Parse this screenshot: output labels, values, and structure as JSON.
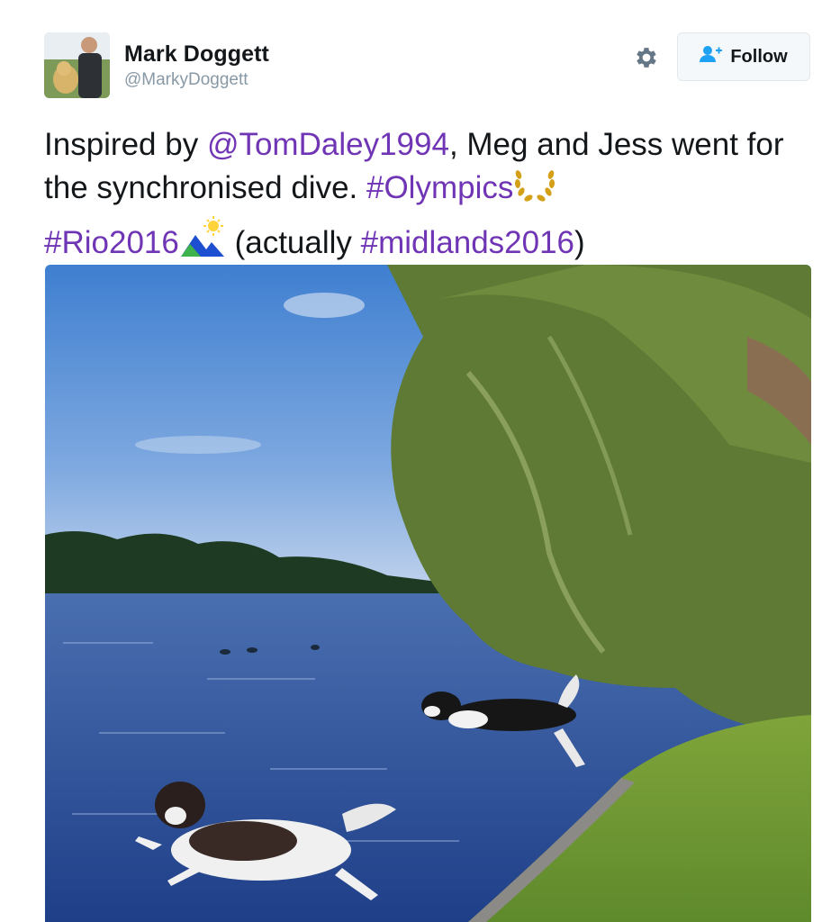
{
  "user": {
    "name": "Mark Doggett",
    "handle": "@MarkyDoggett"
  },
  "follow_button": {
    "label": "Follow"
  },
  "icons": {
    "settings": "gear-icon",
    "follow": "person-plus-icon",
    "olympics_emoji": "laurel-wreath-icon",
    "rio_emoji": "mountain-sun-icon"
  },
  "tweet": {
    "part1": "Inspired by ",
    "mention": "@TomDaley1994",
    "part2": ", Meg and Jess went for the synchronised dive. ",
    "hashtag1": "#Olympics",
    "hashtag2": "#Rio2016",
    "part3": " (actually ",
    "hashtag3": "#midlands2016",
    "part4": ")"
  },
  "colors": {
    "link": "#6f35b5",
    "follow_icon": "#1da1f2",
    "text": "#14171a",
    "muted": "#8899a6"
  }
}
